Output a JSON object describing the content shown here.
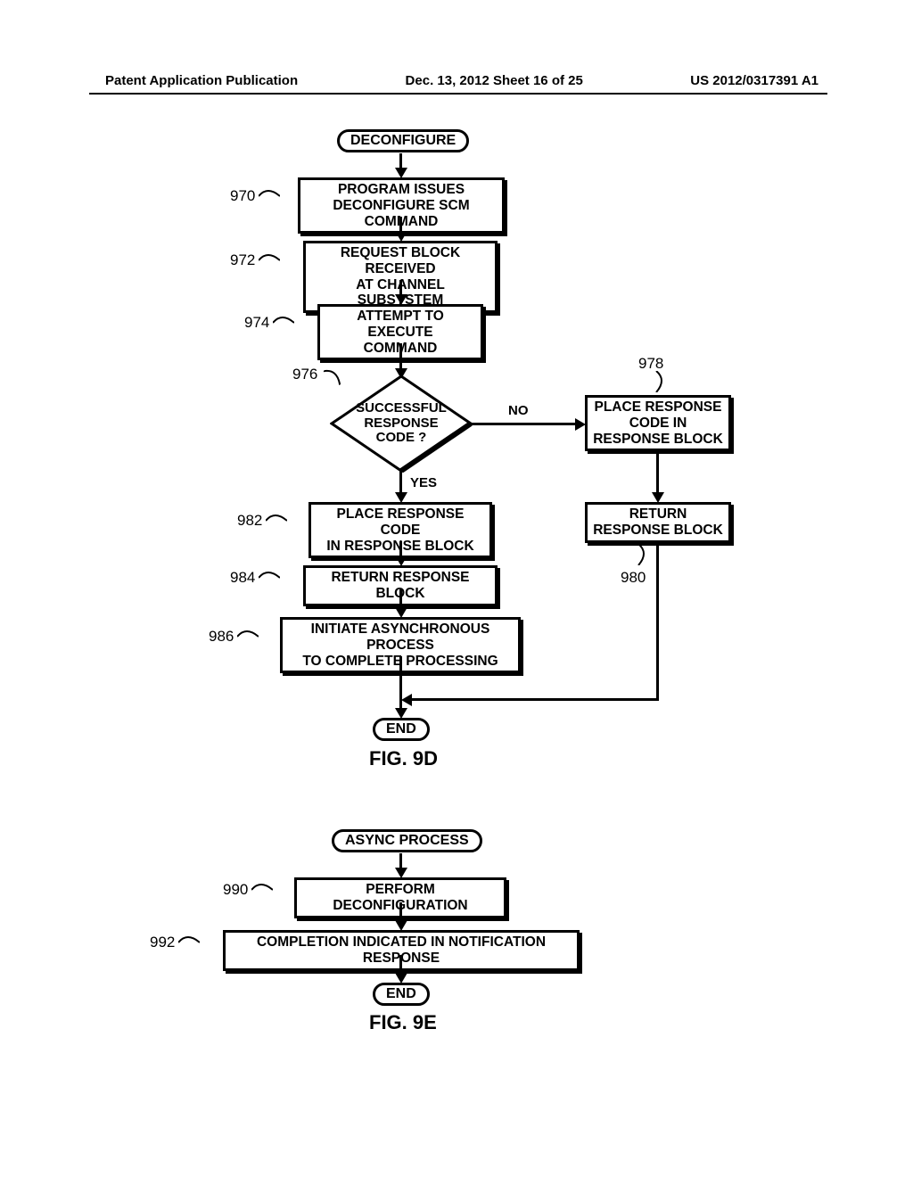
{
  "header": {
    "left": "Patent Application Publication",
    "center": "Dec. 13, 2012  Sheet 16 of 25",
    "right": "US 2012/0317391 A1"
  },
  "fig9d": {
    "start": "DECONFIGURE",
    "n970": "PROGRAM ISSUES\nDECONFIGURE SCM COMMAND",
    "n972": "REQUEST BLOCK RECEIVED\nAT CHANNEL SUBSYSTEM",
    "n974": "ATTEMPT TO EXECUTE\nCOMMAND",
    "n976": "SUCCESSFUL\nRESPONSE\nCODE ?",
    "edge_no": "NO",
    "edge_yes": "YES",
    "n978": "PLACE RESPONSE\nCODE IN\nRESPONSE BLOCK",
    "n980": "RETURN\nRESPONSE BLOCK",
    "n982": "PLACE RESPONSE CODE\nIN RESPONSE BLOCK",
    "n984": "RETURN RESPONSE BLOCK",
    "n986": "INITIATE ASYNCHRONOUS PROCESS\nTO COMPLETE PROCESSING",
    "end": "END",
    "label": "FIG. 9D",
    "refs": {
      "r970": "970",
      "r972": "972",
      "r974": "974",
      "r976": "976",
      "r978": "978",
      "r980": "980",
      "r982": "982",
      "r984": "984",
      "r986": "986"
    }
  },
  "fig9e": {
    "start": "ASYNC PROCESS",
    "n990": "PERFORM DECONFIGURATION",
    "n992": "COMPLETION INDICATED IN NOTIFICATION RESPONSE",
    "end": "END",
    "label": "FIG. 9E",
    "refs": {
      "r990": "990",
      "r992": "992"
    }
  }
}
